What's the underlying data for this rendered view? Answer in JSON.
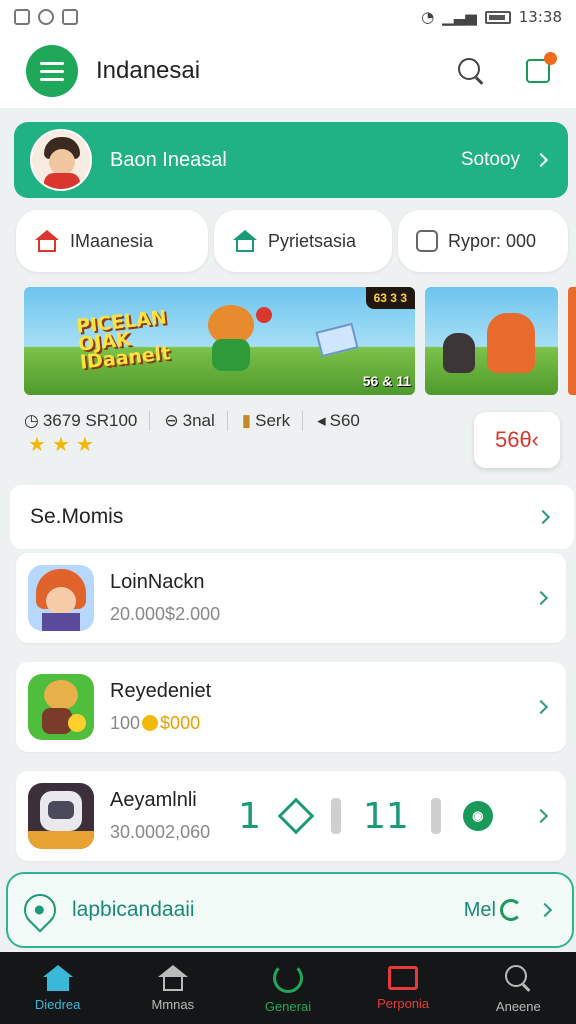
{
  "status_bar": {
    "time": "13:38",
    "left_icons": [
      "notification-icon",
      "chat-icon",
      "app-icon"
    ],
    "right_icons": [
      "wifi-icon",
      "signal-icon",
      "battery-icon"
    ]
  },
  "header": {
    "title": "Indanesai",
    "icons": [
      "menu-icon",
      "search-icon",
      "notification-icon"
    ],
    "accent_color": "#1fa85a",
    "badge_color": "#f06a1e"
  },
  "profile": {
    "name": "Baon Ineasal",
    "action": "Sotooy",
    "bg_color": "#21b283"
  },
  "chips": [
    {
      "label": "IMaanesia",
      "icon": "house-icon"
    },
    {
      "label": "Pyrietsasia",
      "icon": "house-icon"
    },
    {
      "label": "Rypor: 000",
      "icon": "square-icon"
    }
  ],
  "banner": {
    "title_lines": [
      "PICELAN",
      "OJAK",
      "IDaanelt"
    ],
    "badge": "63 3 3",
    "corner_badge": "56 & 11"
  },
  "stats": {
    "items": [
      "3679 SR100",
      "3nal",
      "Serk",
      "S60"
    ],
    "stars": 3
  },
  "float_button": {
    "label": "56θ‹"
  },
  "section": {
    "title": "Se.Momis"
  },
  "games": [
    {
      "name": "LoinNackn",
      "sub": "20.000$2.000"
    },
    {
      "name": "Reyedeniet",
      "sub_prefix": "100",
      "sub_gold": "$000"
    },
    {
      "name": "Aeyamlnli",
      "sub": "30.0002,060",
      "controls": [
        "1",
        "11"
      ]
    }
  ],
  "promo": {
    "text": "lapbicandaaii",
    "more": "Mel"
  },
  "bottom_nav": [
    {
      "label": "Diedrea",
      "icon": "home-icon",
      "state": "active"
    },
    {
      "label": "Mmnas",
      "icon": "house-icon",
      "state": "normal"
    },
    {
      "label": "Generai",
      "icon": "gauge-icon",
      "state": "green"
    },
    {
      "label": "Perponia",
      "icon": "screen-icon",
      "state": "red"
    },
    {
      "label": "Aneene",
      "icon": "search-icon",
      "state": "normal"
    }
  ]
}
